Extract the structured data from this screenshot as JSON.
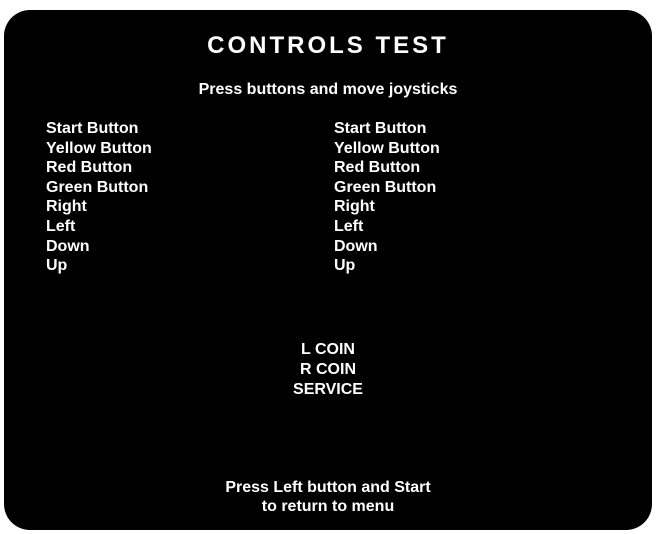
{
  "title": "CONTROLS TEST",
  "subtitle": "Press buttons and move joysticks",
  "player1_controls": [
    "Start Button",
    "Yellow Button",
    "Red Button",
    "Green Button",
    "Right",
    "Left",
    "Down",
    "Up"
  ],
  "player2_controls": [
    "Start Button",
    "Yellow Button",
    "Red Button",
    "Green Button",
    "Right",
    "Left",
    "Down",
    "Up"
  ],
  "coin_inputs": [
    "L COIN",
    "R COIN",
    "SERVICE"
  ],
  "footer": {
    "line1": "Press Left button and Start",
    "line2": "to return to menu"
  },
  "colors": {
    "background": "#000000",
    "text": "#ffffff"
  }
}
